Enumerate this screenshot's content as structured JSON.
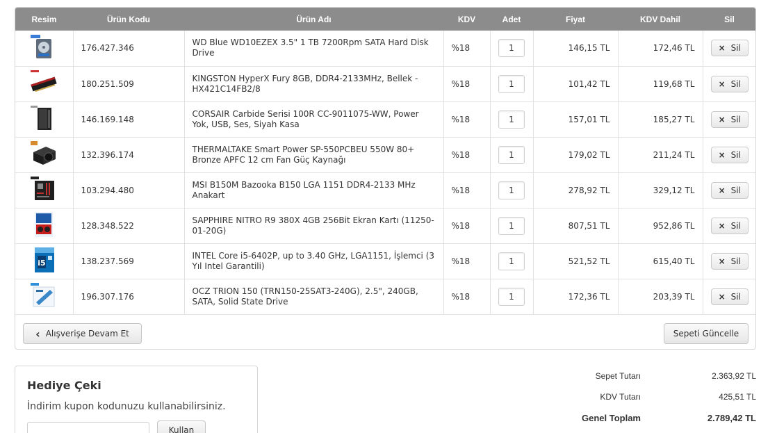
{
  "table": {
    "headers": {
      "image": "Resim",
      "code": "Ürün Kodu",
      "name": "Ürün Adı",
      "kdv": "KDV",
      "qty": "Adet",
      "price": "Fiyat",
      "total": "KDV Dahil",
      "delete": "Sil"
    },
    "rows": [
      {
        "icon": "hard-disk-icon",
        "code": "176.427.346",
        "name": "WD Blue WD10EZEX 3.5\" 1 TB 7200Rpm SATA Hard Disk Drive",
        "kdv": "%18",
        "qty": "1",
        "price": "146,15 TL",
        "total": "172,46 TL",
        "delete": "Sil"
      },
      {
        "icon": "ram-module-icon",
        "code": "180.251.509",
        "name": "KINGSTON HyperX Fury 8GB, DDR4-2133MHz, Bellek - HX421C14FB2/8",
        "kdv": "%18",
        "qty": "1",
        "price": "101,42 TL",
        "total": "119,68 TL",
        "delete": "Sil"
      },
      {
        "icon": "pc-case-icon",
        "code": "146.169.148",
        "name": "CORSAIR Carbide Serisi 100R CC-9011075-WW, Power Yok, USB, Ses, Siyah Kasa",
        "kdv": "%18",
        "qty": "1",
        "price": "157,01 TL",
        "total": "185,27 TL",
        "delete": "Sil"
      },
      {
        "icon": "power-supply-icon",
        "code": "132.396.174",
        "name": "THERMALTAKE Smart Power SP-550PCBEU 550W 80+ Bronze APFC 12 cm Fan Güç Kaynağı",
        "kdv": "%18",
        "qty": "1",
        "price": "179,02 TL",
        "total": "211,24 TL",
        "delete": "Sil"
      },
      {
        "icon": "motherboard-icon",
        "code": "103.294.480",
        "name": "MSI B150M Bazooka B150 LGA 1151 DDR4-2133 MHz Anakart",
        "kdv": "%18",
        "qty": "1",
        "price": "278,92 TL",
        "total": "329,12 TL",
        "delete": "Sil"
      },
      {
        "icon": "graphics-card-icon",
        "code": "128.348.522",
        "name": "SAPPHIRE NITRO R9 380X 4GB 256Bit Ekran Kartı (11250-01-20G)",
        "kdv": "%18",
        "qty": "1",
        "price": "807,51 TL",
        "total": "952,86 TL",
        "delete": "Sil"
      },
      {
        "icon": "cpu-box-icon",
        "code": "138.237.569",
        "name": "INTEL Core i5-6402P, up to 3.40 GHz, LGA1151, İşlemci (3 Yıl Intel Garantili)",
        "kdv": "%18",
        "qty": "1",
        "price": "521,52 TL",
        "total": "615,40 TL",
        "delete": "Sil"
      },
      {
        "icon": "ssd-box-icon",
        "code": "196.307.176",
        "name": "OCZ TRION 150 (TRN150-25SAT3-240G), 2.5\", 240GB, SATA, Solid State Drive",
        "kdv": "%18",
        "qty": "1",
        "price": "172,36 TL",
        "total": "203,39 TL",
        "delete": "Sil"
      }
    ]
  },
  "actions": {
    "continue_shopping": "Alışverişe Devam Et",
    "update_cart": "Sepeti Güncelle",
    "delete_icon": "×"
  },
  "gift": {
    "title": "Hediye Çeki",
    "description": "İndirim kupon kodunuzu kullanabilirsiniz.",
    "apply_button": "Kullan"
  },
  "totals": {
    "subtotal_label": "Sepet Tutarı",
    "subtotal_value": "2.363,92 TL",
    "tax_label": "KDV Tutarı",
    "tax_value": "425,51 TL",
    "grand_label": "Genel Toplam",
    "grand_value": "2.789,42 TL"
  },
  "colors": {
    "header_bg": "#8c8c8c",
    "link": "#3a7ab7"
  }
}
